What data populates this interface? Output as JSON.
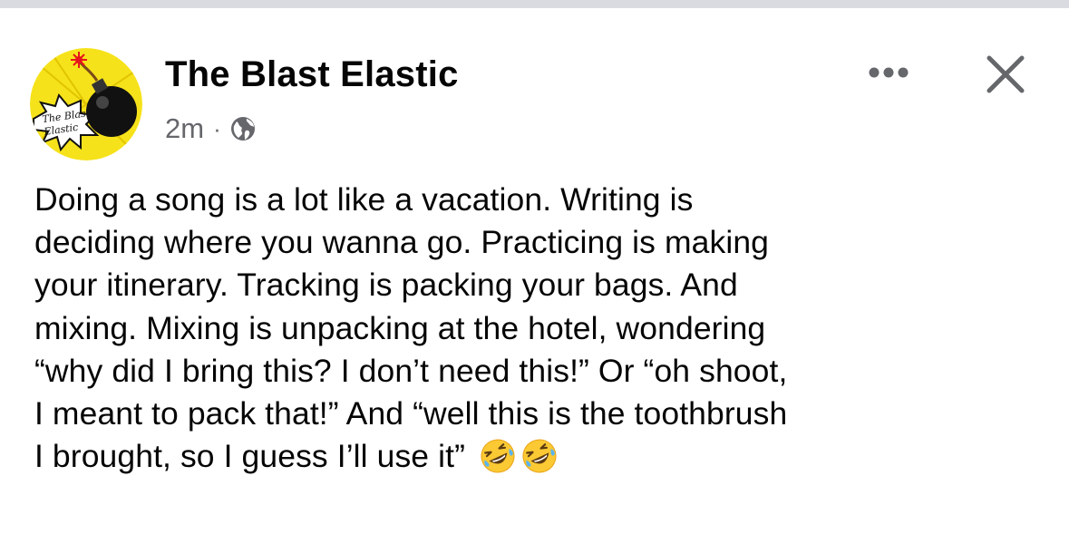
{
  "post": {
    "author": "The Blast Elastic",
    "timestamp": "2m",
    "separator": "·",
    "privacy_icon": "globe-icon",
    "avatar_text": [
      "The Blast",
      "Elastic"
    ],
    "text_lines": [
      "Doing a song is a lot like a vacation. Writing is",
      "deciding where you wanna go. Practicing is making",
      "your itinerary. Tracking is packing your bags. And",
      "mixing. Mixing is unpacking at the hotel, wondering",
      "“why did I bring this? I don’t need this!” Or “oh shoot,",
      "I meant to pack that!” And “well this is the toothbrush",
      "I brought, so I guess I’ll use it”"
    ],
    "emojis": [
      "rolling-on-floor-laughing-emoji",
      "rolling-on-floor-laughing-emoji"
    ]
  },
  "actions": {
    "more_icon": "more-options-icon",
    "close_icon": "close-icon"
  },
  "colors": {
    "text": "#050505",
    "secondary_text": "#65676b",
    "divider": "#d9dbe0",
    "avatar_yellow": "#f6e21a",
    "emoji_yellow": "#fbc933"
  }
}
